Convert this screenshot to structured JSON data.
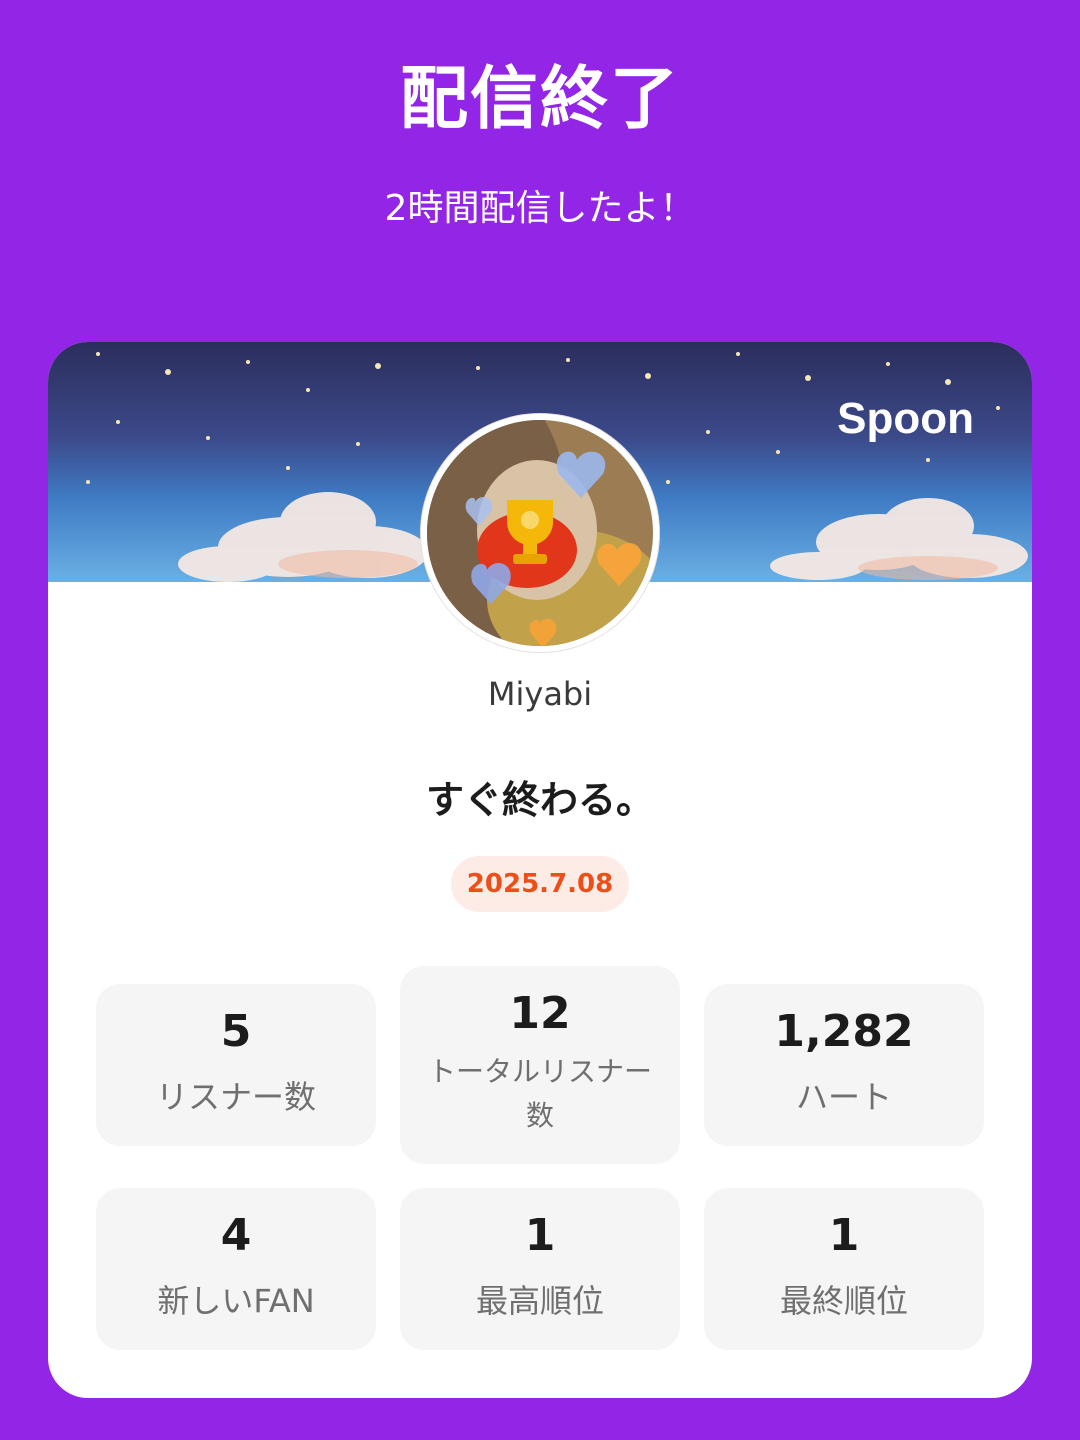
{
  "header": {
    "title": "配信終了",
    "subtitle": "2時間配信したよ！"
  },
  "card": {
    "brand": "Spoon",
    "username": "Miyabi",
    "stream_title": "すぐ終わる。",
    "date": "2025.7.08",
    "colors": {
      "background": "#9225e6",
      "date_text": "#ec4f17",
      "date_badge": "#fdebe5",
      "stat_tile": "#f5f5f5"
    },
    "stats": [
      {
        "value": "5",
        "label": "リスナー数"
      },
      {
        "value": "12",
        "label": "トータルリスナー数"
      },
      {
        "value": "1,282",
        "label": "ハート"
      },
      {
        "value": "4",
        "label": "新しいFAN"
      },
      {
        "value": "1",
        "label": "最高順位"
      },
      {
        "value": "1",
        "label": "最終順位"
      }
    ]
  }
}
